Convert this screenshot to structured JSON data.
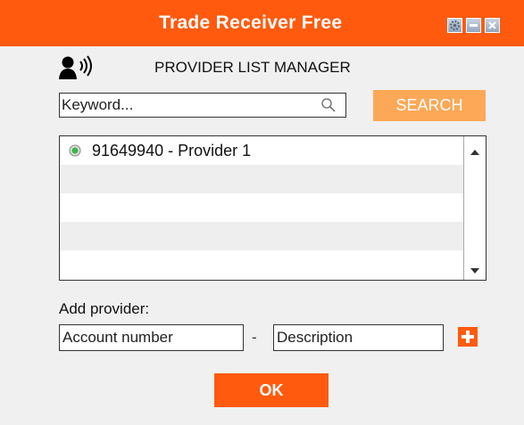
{
  "window": {
    "title": "Trade Receiver Free",
    "controls": [
      "settings-icon",
      "minimize-icon",
      "close-icon"
    ]
  },
  "header": {
    "icon": "speaker-user-icon",
    "title": "PROVIDER LIST MANAGER"
  },
  "search": {
    "placeholder": "Keyword...",
    "value": "",
    "icon": "magnifier-icon",
    "button_label": "SEARCH"
  },
  "provider_list": {
    "items": [
      {
        "label": "91649940 - Provider 1",
        "status": "active",
        "status_color": "#39b54a"
      }
    ]
  },
  "add_provider": {
    "label": "Add provider:",
    "account_placeholder": "Account number",
    "separator": "-",
    "description_placeholder": "Description",
    "add_icon": "plus-icon"
  },
  "footer": {
    "ok_label": "OK"
  },
  "colors": {
    "accent": "#ff5a0e",
    "search_button": "#fca857",
    "background": "#f0f0f0"
  }
}
